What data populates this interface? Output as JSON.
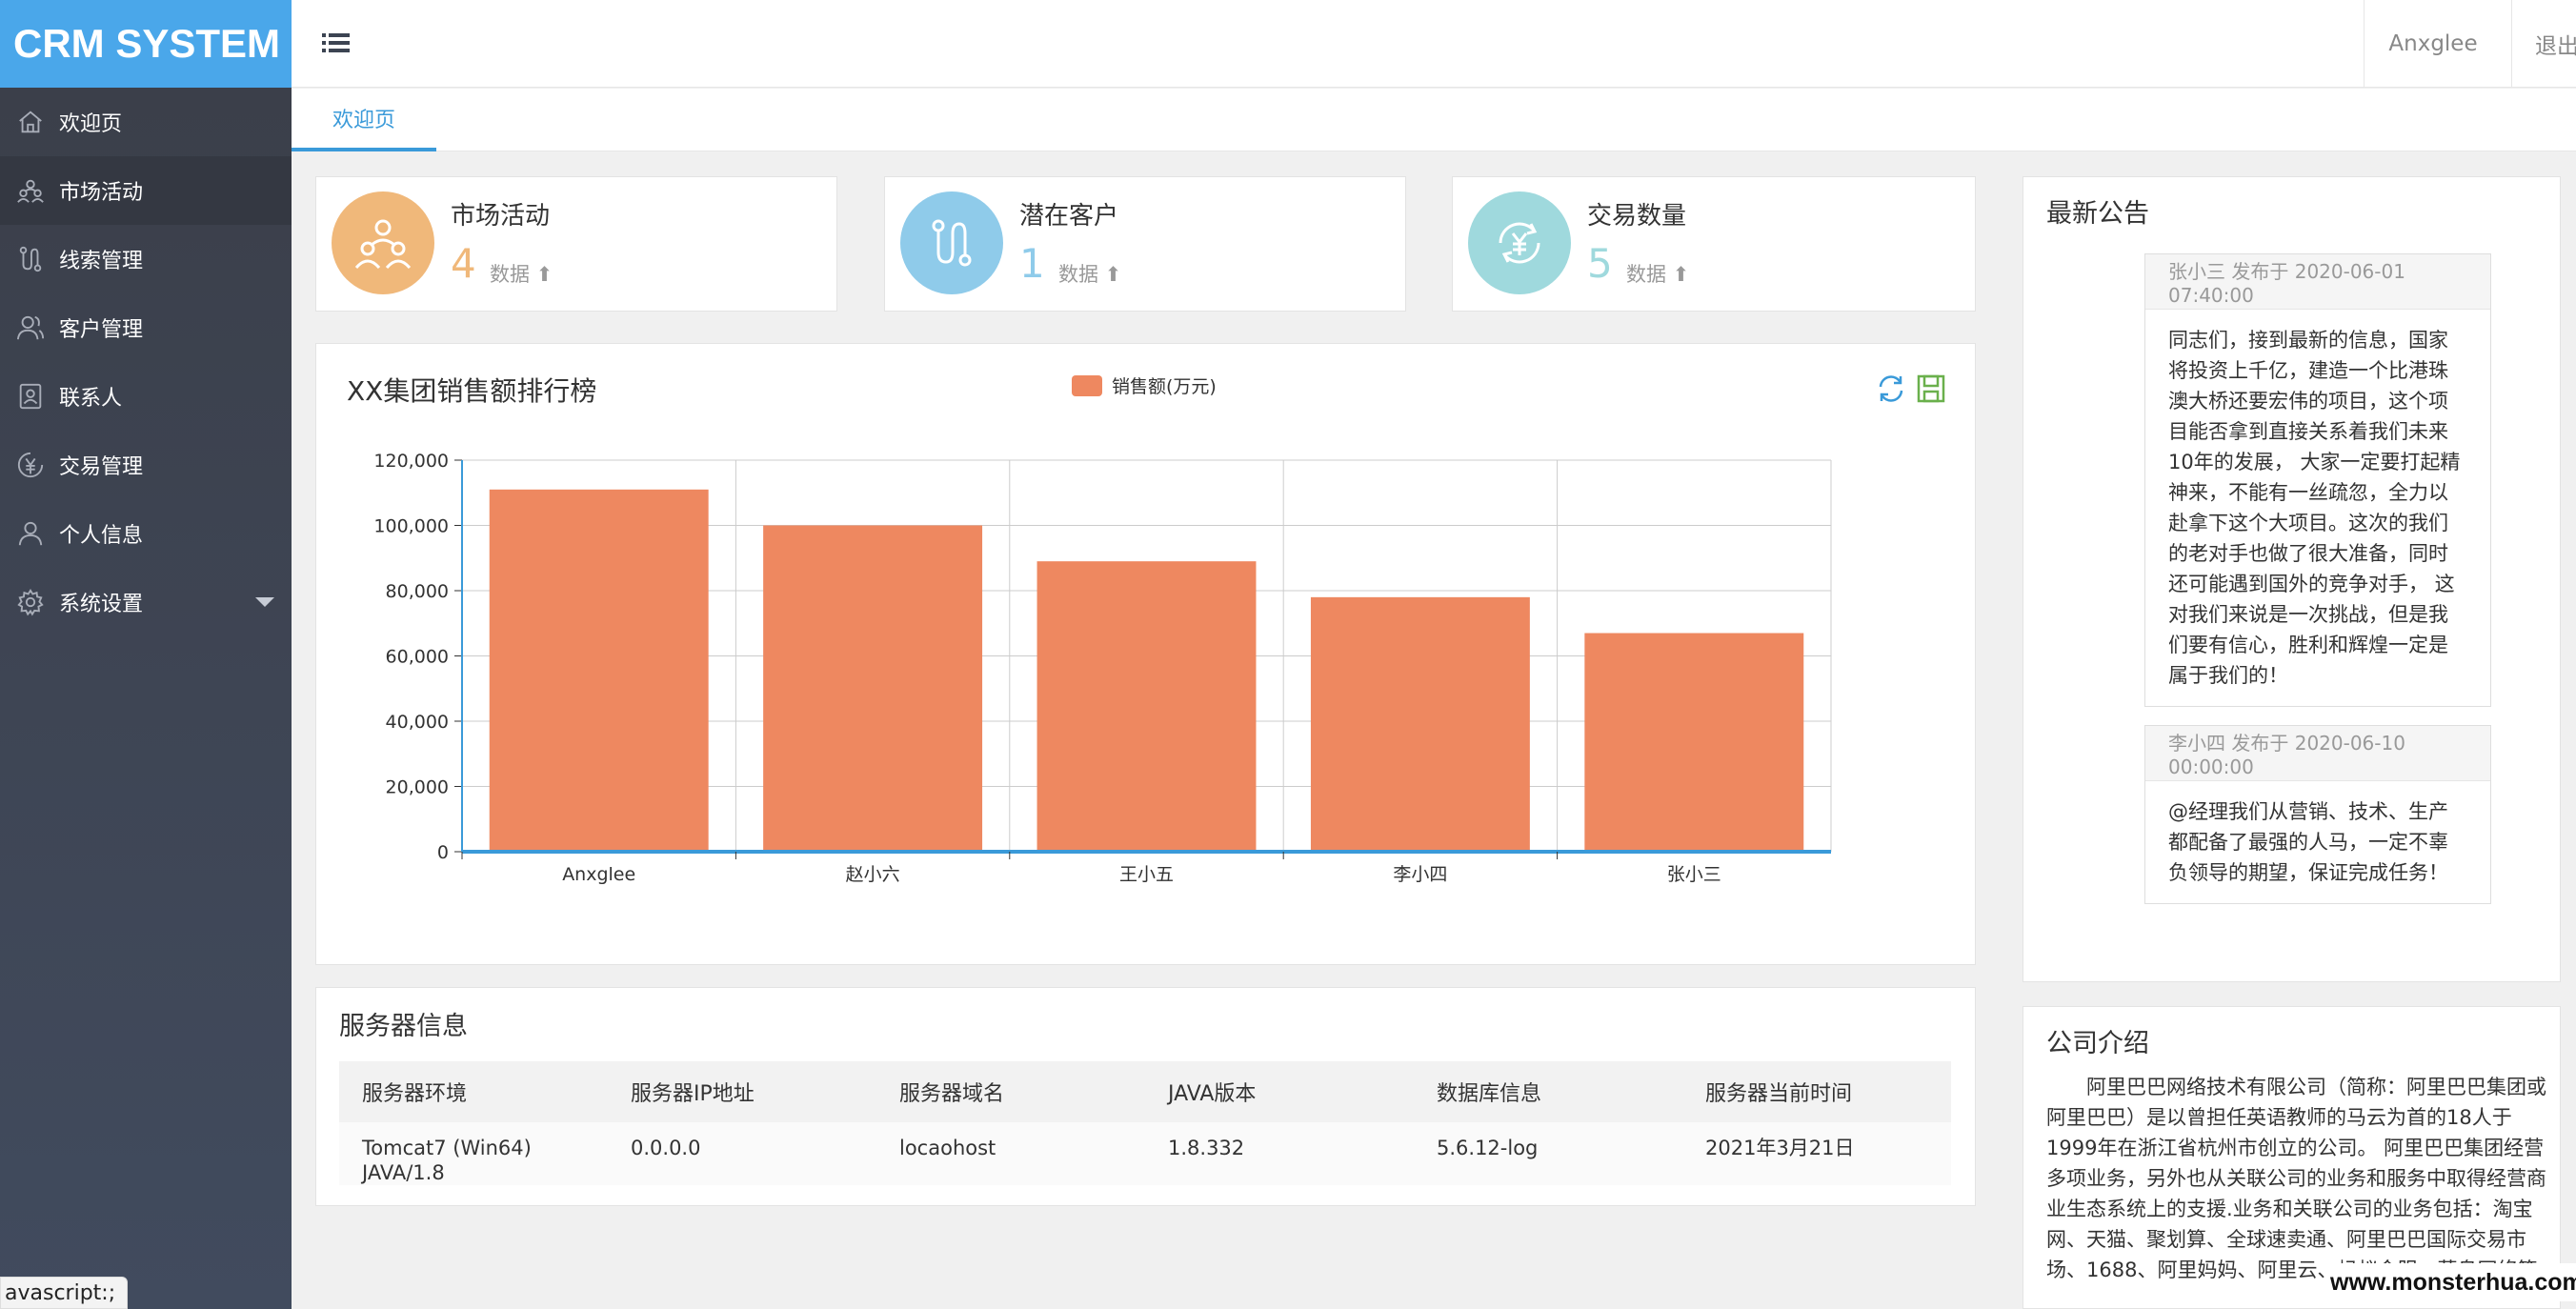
{
  "app": {
    "logo": "CRM SYSTEM"
  },
  "sidebar": {
    "items": [
      {
        "label": "欢迎页",
        "icon": "home-icon"
      },
      {
        "label": "市场活动",
        "icon": "people-icon"
      },
      {
        "label": "线索管理",
        "icon": "path-icon"
      },
      {
        "label": "客户管理",
        "icon": "user-group-icon"
      },
      {
        "label": "联系人",
        "icon": "contact-card-icon"
      },
      {
        "label": "交易管理",
        "icon": "yen-icon"
      },
      {
        "label": "个人信息",
        "icon": "user-icon"
      },
      {
        "label": "系统设置",
        "icon": "gear-icon"
      }
    ]
  },
  "header": {
    "user": "Anxglee",
    "logout": "退出"
  },
  "tabs": [
    {
      "label": "欢迎页"
    }
  ],
  "stats": [
    {
      "title": "市场活动",
      "value": "4",
      "unit": "数据",
      "color": "#f0b87a",
      "value_color": "#f0b87a",
      "icon": "people-icon"
    },
    {
      "title": "潜在客户",
      "value": "1",
      "unit": "数据",
      "color": "#8fcbea",
      "value_color": "#8fcbea",
      "icon": "path-icon"
    },
    {
      "title": "交易数量",
      "value": "5",
      "unit": "数据",
      "color": "#9fd9dd",
      "value_color": "#9fd9dd",
      "icon": "yen-cycle-icon"
    }
  ],
  "chart_data": {
    "type": "bar",
    "title": "XX集团销售额排行榜",
    "categories": [
      "Anxglee",
      "赵小六",
      "王小五",
      "李小四",
      "张小三"
    ],
    "series": [
      {
        "name": "销售额(万元)",
        "values": [
          111000,
          100000,
          89000,
          78000,
          67000
        ],
        "color": "#ee8860"
      }
    ],
    "ylim": [
      0,
      120000
    ],
    "yticks": [
      "0",
      "20,000",
      "40,000",
      "60,000",
      "80,000",
      "100,000",
      "120,000"
    ],
    "grid": true,
    "legend": "top-center"
  },
  "server": {
    "title": "服务器信息",
    "columns": [
      "服务器环境",
      "服务器IP地址",
      "服务器域名",
      "JAVA版本",
      "数据库信息",
      "服务器当前时间"
    ],
    "row": [
      "Tomcat7 (Win64) JAVA/1.8",
      "0.0.0.0",
      "locaohost",
      "1.8.332",
      "5.6.12-log",
      "2021年3月21日"
    ]
  },
  "notices": {
    "title": "最新公告",
    "items": [
      {
        "head": "张小三 发布于 2020-06-01 07:40:00",
        "body": "同志们，接到最新的信息，国家将投资上千亿，建造一个比港珠澳大桥还要宏伟的项目，这个项目能否拿到直接关系着我们未来10年的发展， 大家一定要打起精神来，不能有一丝疏忽，全力以赴拿下这个大项目。这次的我们的老对手也做了很大准备，同时还可能遇到国外的竞争对手， 这对我们来说是一次挑战，但是我们要有信心，胜利和辉煌一定是属于我们的！"
      },
      {
        "head": "李小四 发布于 2020-06-10 00:00:00",
        "body": "@经理我们从营销、技术、生产都配备了最强的人马，一定不辜负领导的期望，保证完成任务！"
      }
    ]
  },
  "company": {
    "title": "公司介绍",
    "text": "阿里巴巴网络技术有限公司（简称：阿里巴巴集团或阿里巴巴）是以曾担任英语教师的马云为首的18人于1999年在浙江省杭州市创立的公司。 阿里巴巴集团经营多项业务，另外也从关联公司的业务和服务中取得经营商业生态系统上的支援.业务和关联公司的业务包括：淘宝网、天猫、聚划算、全球速卖通、阿里巴巴国际交易市场、1688、阿里妈妈、阿里云、蚂蚁金服、菜鸟网络等。"
  },
  "status_tip": "avascript:;",
  "watermark": "www.monsterhua.com"
}
